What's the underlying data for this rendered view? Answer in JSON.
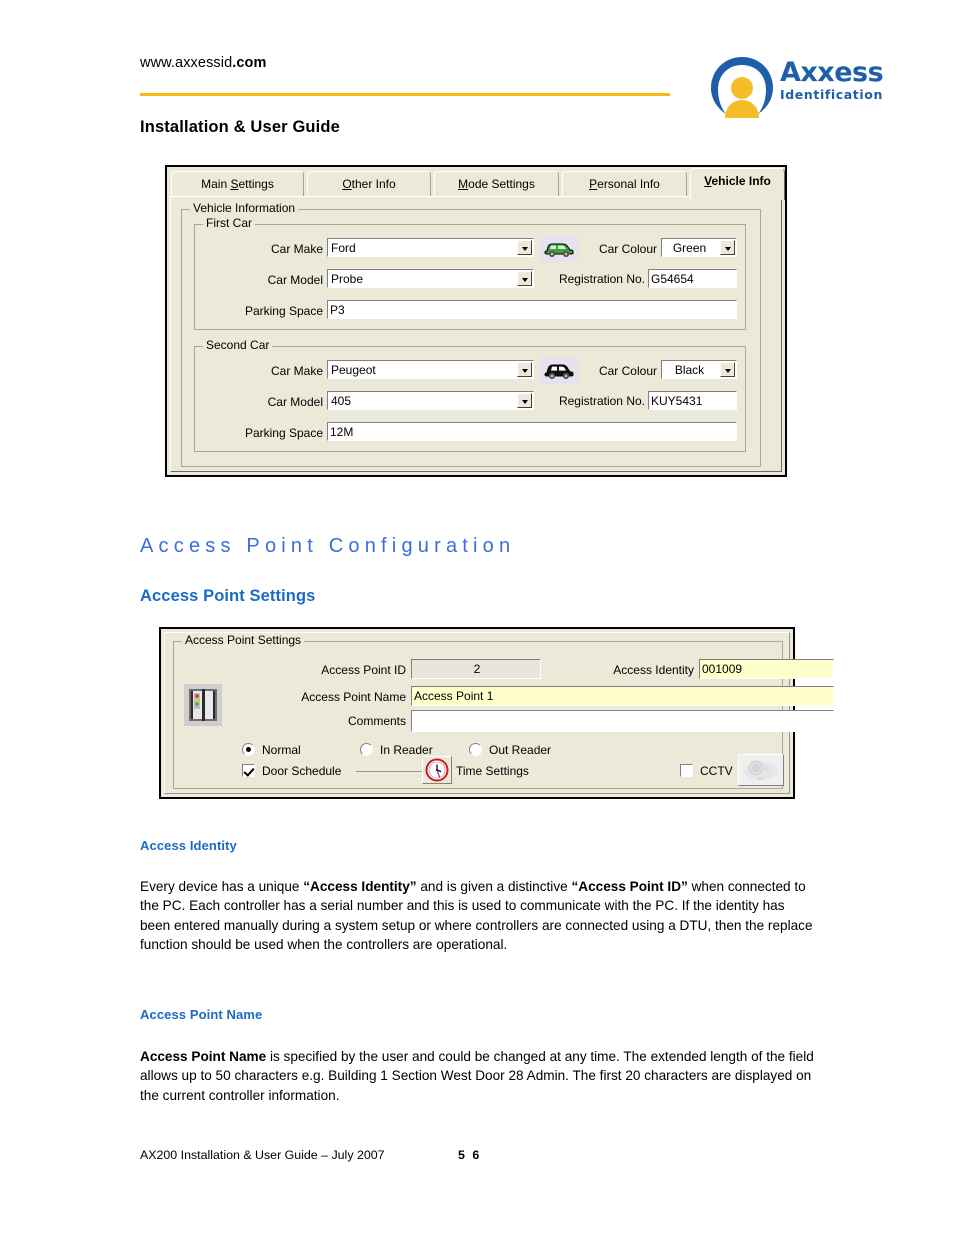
{
  "header": {
    "site_url_plain": "www.axxessid",
    "site_url_bold": ".com",
    "doc_title": "Installation & User Guide",
    "logo_word": "Axxess",
    "logo_sub": "Identification",
    "rule_color": "#f5bc18",
    "logo_blue": "#1f5fa9",
    "logo_yellow": "#f5bc18"
  },
  "vehicle_dialog": {
    "tabs": [
      {
        "label": "Main Settings",
        "accel": "S",
        "before": "Main ",
        "after": "ettings",
        "selected": false
      },
      {
        "label": "Other Info",
        "accel": "O",
        "before": "",
        "after": "ther Info",
        "selected": false
      },
      {
        "label": "Mode Settings",
        "accel": "M",
        "before": "",
        "after": "ode Settings",
        "selected": false
      },
      {
        "label": "Personal Info",
        "accel": "P",
        "before": "",
        "after": "ersonal Info",
        "selected": false
      },
      {
        "label": "Vehicle Info",
        "accel": "V",
        "before": "",
        "after": "ehicle Info",
        "selected": true
      }
    ],
    "group_title": "Vehicle Information",
    "first_car": {
      "group_title": "First Car",
      "car_make_label": "Car Make",
      "car_make_value": "Ford",
      "car_model_label": "Car Model",
      "car_model_value": "Probe",
      "parking_space_label": "Parking Space",
      "parking_space_value": "P3",
      "car_colour_label": "Car Colour",
      "car_colour_value": "Green",
      "registration_label": "Registration No.",
      "registration_value": "G54654",
      "car_icon_colour": "#3ca03c"
    },
    "second_car": {
      "group_title": "Second Car",
      "car_make_label": "Car Make",
      "car_make_value": "Peugeot",
      "car_model_label": "Car Model",
      "car_model_value": "405",
      "parking_space_label": "Parking Space",
      "parking_space_value": "12M",
      "car_colour_label": "Car Colour",
      "car_colour_value": "Black",
      "registration_label": "Registration No.",
      "registration_value": "KUY5431",
      "car_icon_colour": "#111111"
    }
  },
  "section": {
    "h1": "Access Point Configuration",
    "h2": "Access Point Settings",
    "heading_blue": "#1a6bc4"
  },
  "ap_dialog": {
    "group_title": "Access Point Settings",
    "access_point_id_label": "Access Point ID",
    "access_point_id_value": "2",
    "access_identity_label": "Access Identity",
    "access_identity_value": "001009",
    "access_point_name_label": "Access Point Name",
    "access_point_name_value": "Access Point 1",
    "comments_label": "Comments",
    "comments_value": "",
    "radio_normal": "Normal",
    "radio_in_reader": "In Reader",
    "radio_out_reader": "Out Reader",
    "radio_selected": "Normal",
    "checkbox_door_schedule": "Door Schedule",
    "door_schedule_checked": true,
    "time_settings_label": "Time Settings",
    "checkbox_cctv": "CCTV",
    "cctv_checked": false,
    "field_highlight_color": "#ffffcc"
  },
  "content": {
    "sub1_heading": "Access Identity",
    "sub1_p_a": "Every device has a unique ",
    "sub1_p_b": "“Access Identity”",
    "sub1_p_c": " and is given a distinctive ",
    "sub1_p_d": "“Access Point ID”",
    "sub1_p_e": " when connected to the PC. Each controller has a serial number and this is used to communicate with the PC. If the identity has been entered manually during a system setup or where controllers are connected using a DTU, then the replace function should be used when the controllers are operational.",
    "sub2_heading": "Access Point Name",
    "sub2_p_a": "Access Point Name",
    "sub2_p_b": " is specified by the user and could be changed at any time. The extended length of the field allows up to 50 characters e.g. Building 1 Section West Door 28 Admin.  The first 20 characters are displayed on the current controller information."
  },
  "footer": {
    "left": "AX200 Installation & User Guide – July 2007",
    "page": "5 6"
  }
}
